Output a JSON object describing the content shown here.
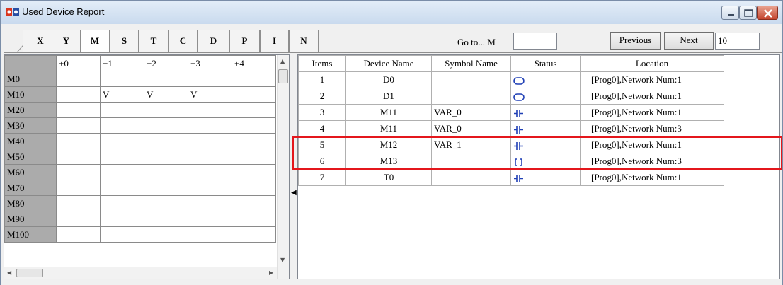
{
  "window": {
    "title": "Used Device Report",
    "accent_highlight": "#e4171c"
  },
  "tabs": [
    "X",
    "Y",
    "M",
    "S",
    "T",
    "C",
    "D",
    "P",
    "I",
    "N"
  ],
  "active_tab": "M",
  "goto": {
    "label": "Go to... M",
    "value": ""
  },
  "nav": {
    "previous_label": "Previous",
    "next_label": "Next",
    "count_value": "10"
  },
  "grid": {
    "columns": [
      "+0",
      "+1",
      "+2",
      "+3",
      "+4"
    ],
    "rows": [
      {
        "label": "M0",
        "cells": [
          "",
          "",
          "",
          "",
          ""
        ]
      },
      {
        "label": "M10",
        "cells": [
          "",
          "V",
          "V",
          "V",
          ""
        ]
      },
      {
        "label": "M20",
        "cells": [
          "",
          "",
          "",
          "",
          ""
        ]
      },
      {
        "label": "M30",
        "cells": [
          "",
          "",
          "",
          "",
          ""
        ]
      },
      {
        "label": "M40",
        "cells": [
          "",
          "",
          "",
          "",
          ""
        ]
      },
      {
        "label": "M50",
        "cells": [
          "",
          "",
          "",
          "",
          ""
        ]
      },
      {
        "label": "M60",
        "cells": [
          "",
          "",
          "",
          "",
          ""
        ]
      },
      {
        "label": "M70",
        "cells": [
          "",
          "",
          "",
          "",
          ""
        ]
      },
      {
        "label": "M80",
        "cells": [
          "",
          "",
          "",
          "",
          ""
        ]
      },
      {
        "label": "M90",
        "cells": [
          "",
          "",
          "",
          "",
          ""
        ]
      },
      {
        "label": "M100",
        "cells": [
          "",
          "",
          "",
          "",
          ""
        ]
      }
    ]
  },
  "report": {
    "headers": [
      "Items",
      "Device Name",
      "Symbol Name",
      "Status",
      "Location"
    ],
    "rows": [
      {
        "item": "1",
        "device": "D0",
        "symbol": "",
        "status": "coil-output-icon",
        "location": "[Prog0],Network Num:1"
      },
      {
        "item": "2",
        "device": "D1",
        "symbol": "",
        "status": "coil-output-icon",
        "location": "[Prog0],Network Num:1"
      },
      {
        "item": "3",
        "device": "M11",
        "symbol": "VAR_0",
        "status": "contact-no-icon",
        "location": "[Prog0],Network Num:1"
      },
      {
        "item": "4",
        "device": "M11",
        "symbol": "VAR_0",
        "status": "contact-no-icon",
        "location": "[Prog0],Network Num:3"
      },
      {
        "item": "5",
        "device": "M12",
        "symbol": "VAR_1",
        "status": "contact-no-icon",
        "location": "[Prog0],Network Num:1"
      },
      {
        "item": "6",
        "device": "M13",
        "symbol": "",
        "status": "coil-bracket-icon",
        "location": "[Prog0],Network Num:3"
      },
      {
        "item": "7",
        "device": "T0",
        "symbol": "",
        "status": "contact-no-icon",
        "location": "[Prog0],Network Num:1"
      }
    ]
  }
}
